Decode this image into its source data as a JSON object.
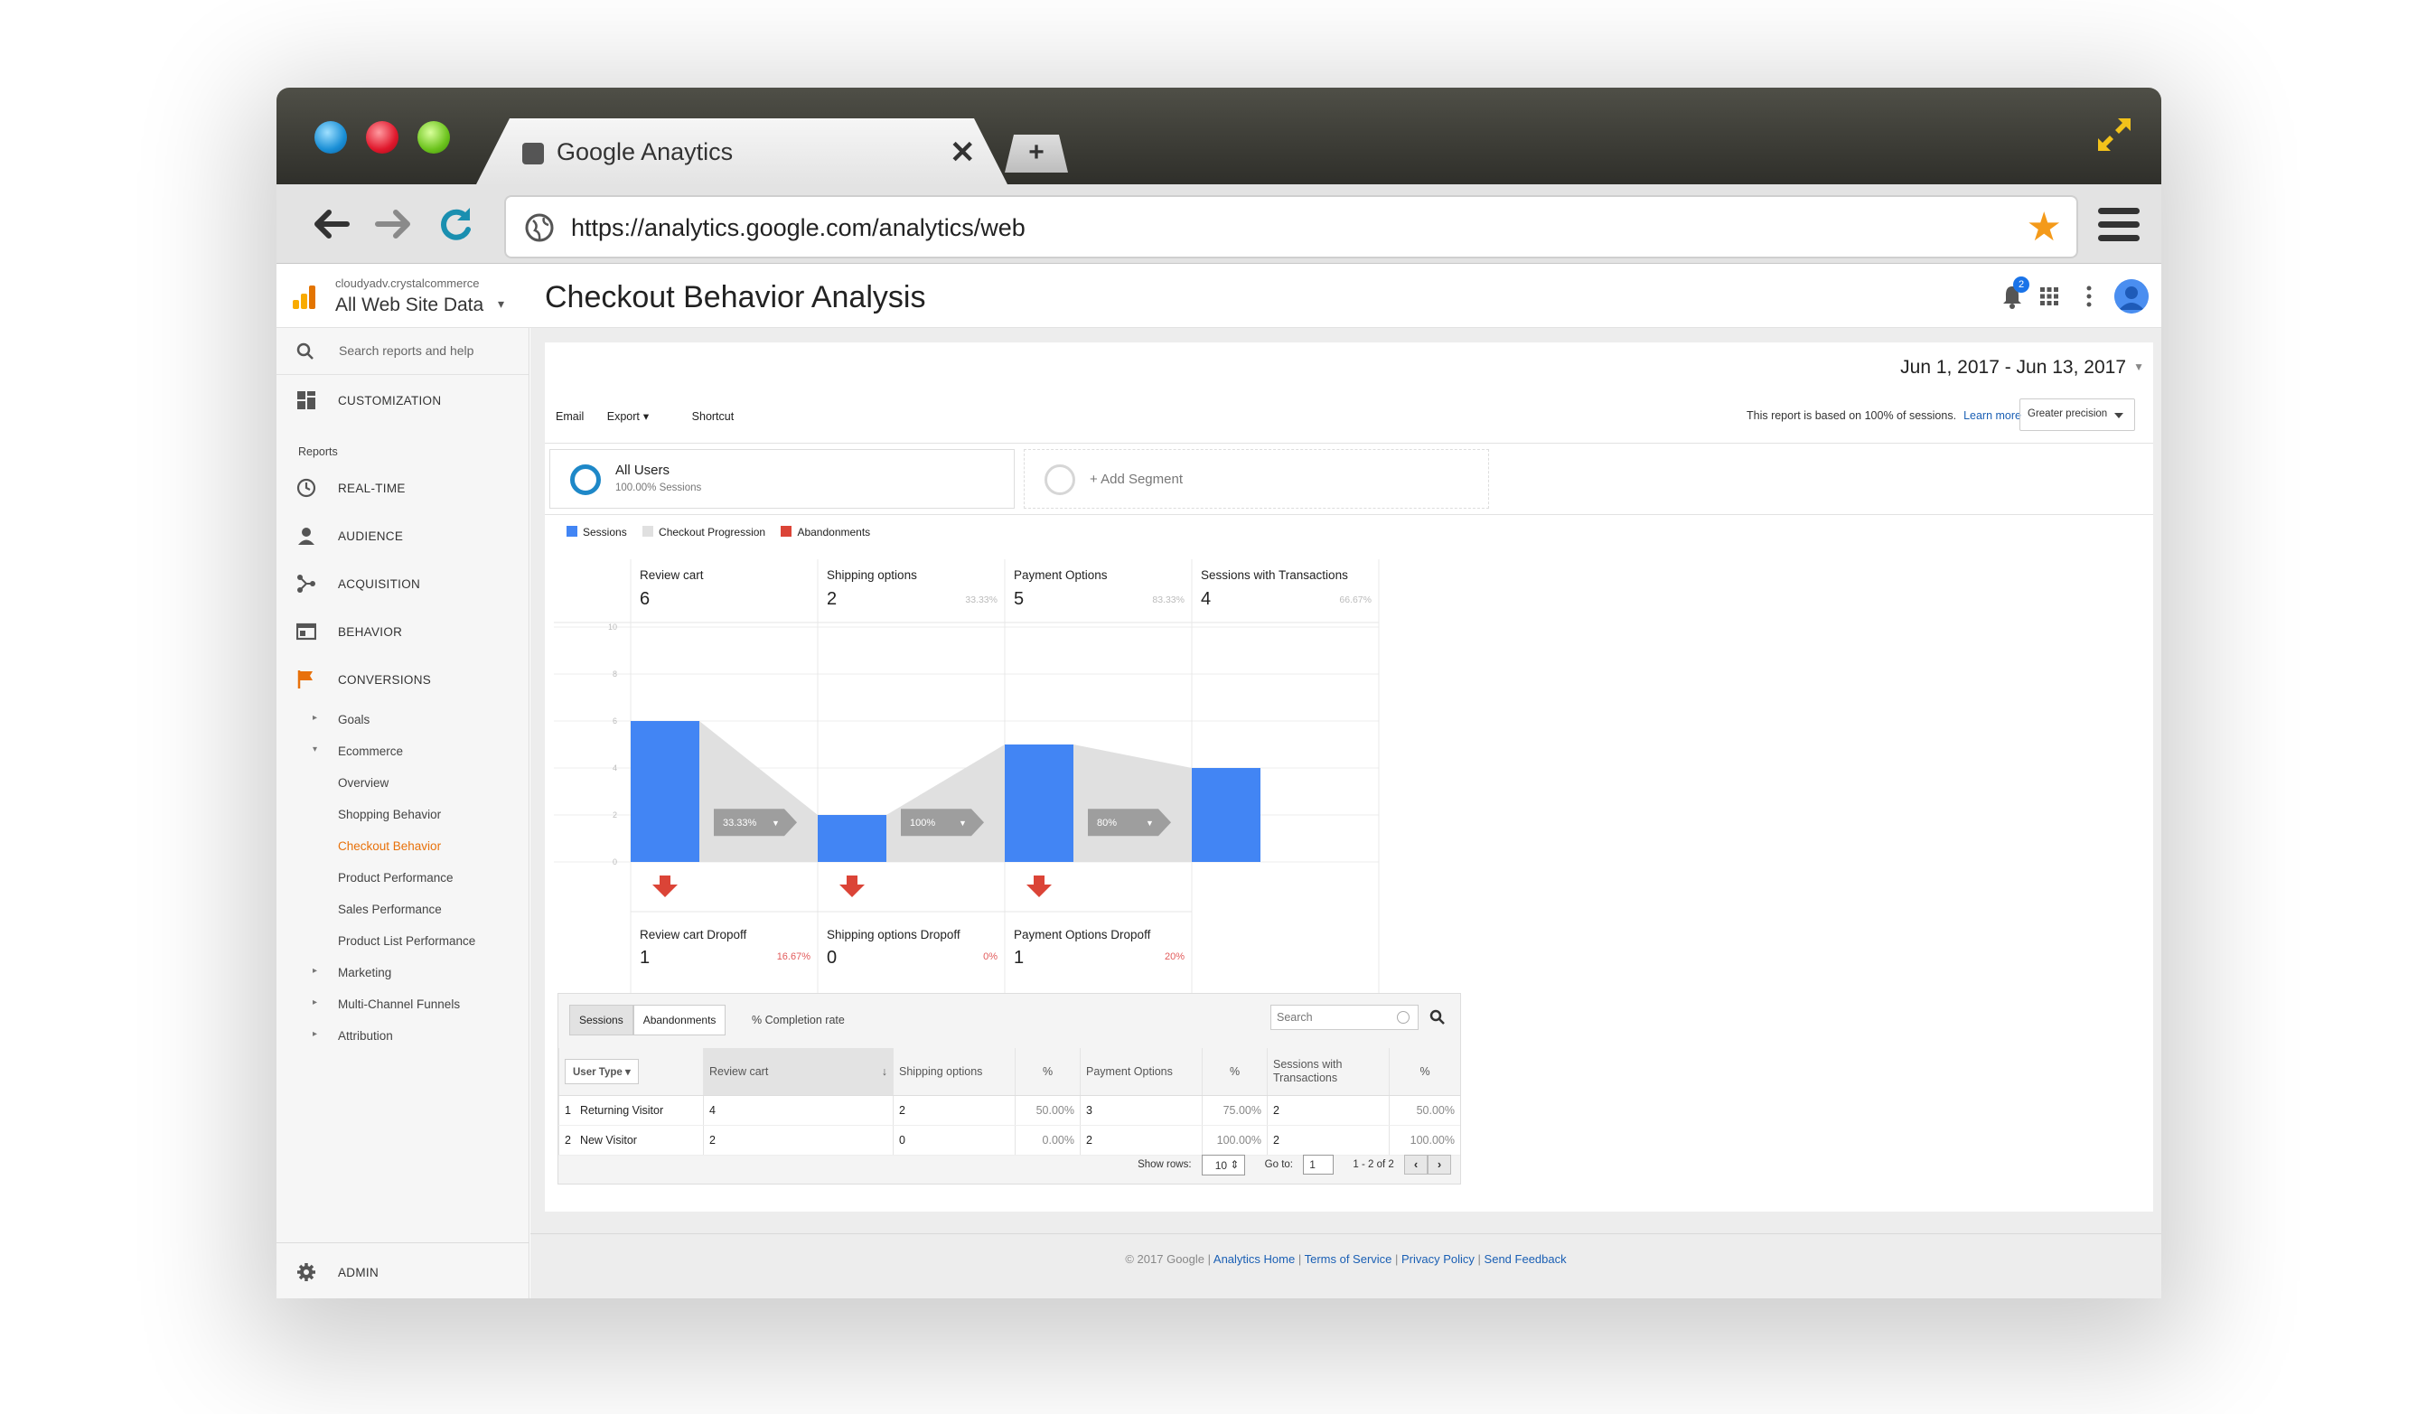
{
  "browser": {
    "tab_title": "Google Anaytics",
    "url": "https://analytics.google.com/analytics/web",
    "colors": {
      "traffic_blue": "#1a8fd6",
      "traffic_red": "#e0182c",
      "traffic_green": "#6cc31d",
      "star": "#f49a1a"
    }
  },
  "header": {
    "account": "cloudyadv.crystalcommerce",
    "property": "All Web Site Data",
    "page_title": "Checkout Behavior Analysis",
    "notification_count": "2"
  },
  "sidebar": {
    "search_placeholder": "Search reports and help",
    "customization": "CUSTOMIZATION",
    "reports_heading": "Reports",
    "items": [
      {
        "label": "REAL-TIME",
        "icon": "clock-icon"
      },
      {
        "label": "AUDIENCE",
        "icon": "person-icon"
      },
      {
        "label": "ACQUISITION",
        "icon": "acquisition-icon"
      },
      {
        "label": "BEHAVIOR",
        "icon": "behavior-icon"
      },
      {
        "label": "CONVERSIONS",
        "icon": "flag-icon"
      }
    ],
    "sub": [
      {
        "label": "Goals",
        "arrow": "▸"
      },
      {
        "label": "Ecommerce",
        "arrow": "▾"
      },
      {
        "label": "Overview"
      },
      {
        "label": "Shopping Behavior"
      },
      {
        "label": "Checkout Behavior"
      },
      {
        "label": "Product Performance"
      },
      {
        "label": "Sales Performance"
      },
      {
        "label": "Product List Performance"
      },
      {
        "label": "Marketing",
        "arrow": "▸"
      },
      {
        "label": "Multi-Channel Funnels",
        "arrow": "▸"
      },
      {
        "label": "Attribution",
        "arrow": "▸"
      }
    ],
    "admin": "ADMIN",
    "colors": {
      "active": "#e8710a",
      "conversions_icon": "#e8710a"
    }
  },
  "toolbar": {
    "date_range": "Jun 1, 2017 - Jun 13, 2017",
    "email": "Email",
    "export": "Export",
    "shortcut": "Shortcut",
    "note": "This report is based on 100% of sessions.",
    "learn_more": "Learn more",
    "precision": "Greater precision"
  },
  "segments": {
    "all_users": "All Users",
    "all_users_sub": "100.00% Sessions",
    "add": "+ Add Segment"
  },
  "legend": [
    "Sessions",
    "Checkout Progression",
    "Abandonments"
  ],
  "chart_data": {
    "type": "bar",
    "categories": [
      "Review cart",
      "Shipping options",
      "Payment Options",
      "Sessions with Transactions"
    ],
    "values": [
      6,
      2,
      5,
      4
    ],
    "ylim": [
      0,
      10
    ],
    "y_ticks": [
      "0",
      "2",
      "4",
      "6",
      "8",
      "10"
    ],
    "step_percents": [
      "",
      "33.33%",
      "83.33%",
      "66.67%"
    ],
    "progression_labels": [
      "33.33%",
      "100%",
      "80%"
    ],
    "dropoffs": [
      {
        "label": "Review cart Dropoff",
        "value": "1",
        "percent": "16.67%"
      },
      {
        "label": "Shipping options Dropoff",
        "value": "0",
        "percent": "0%"
      },
      {
        "label": "Payment Options Dropoff",
        "value": "1",
        "percent": "20%"
      }
    ],
    "colors": {
      "sessions": "#4285f4",
      "progression": "#e0e0e0",
      "abandonments": "#db4437",
      "arrow_tag": "#9e9e9e"
    }
  },
  "table": {
    "tabs": [
      "Sessions",
      "Abandonments"
    ],
    "completion": "% Completion rate",
    "search_placeholder": "Search",
    "headers": [
      "User Type",
      "Review cart",
      "Shipping options",
      "%",
      "Payment Options",
      "%",
      "Sessions with Transactions",
      "%"
    ],
    "rows": [
      [
        "1",
        "Returning Visitor",
        "4",
        "2",
        "50.00%",
        "3",
        "75.00%",
        "2",
        "50.00%"
      ],
      [
        "2",
        "New Visitor",
        "2",
        "0",
        "0.00%",
        "2",
        "100.00%",
        "2",
        "100.00%"
      ]
    ],
    "show_rows_label": "Show rows:",
    "show_rows": "10",
    "goto_label": "Go to:",
    "goto": "1",
    "range": "1 - 2 of 2"
  },
  "footer": {
    "copyright": "© 2017 Google |",
    "links": [
      "Analytics Home",
      "Terms of Service",
      "Privacy Policy",
      "Send Feedback"
    ]
  }
}
